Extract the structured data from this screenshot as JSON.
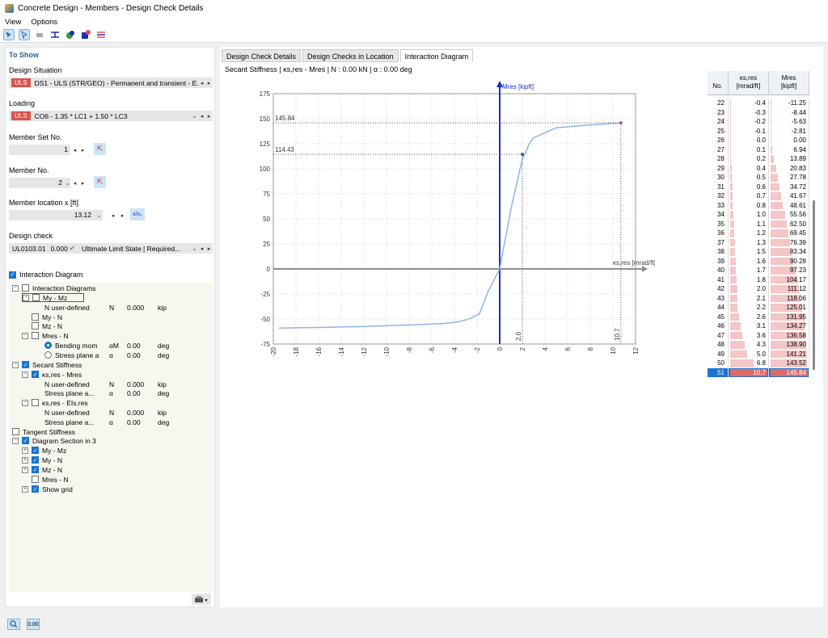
{
  "window": {
    "title": "Concrete Design - Members - Design Check Details"
  },
  "menu": [
    "View",
    "Options"
  ],
  "toolbar": {
    "icons": [
      "select-icon",
      "select-member-icon",
      "eraser-icon",
      "section-icon",
      "result-ok-icon",
      "result-warning-icon",
      "diagram-icon"
    ]
  },
  "left": {
    "to_show": "To Show",
    "design_situation_label": "Design Situation",
    "design_situation_tag": "ULS",
    "design_situation_value": "DS1 - ULS (STR/GEO) - Permanent and transient - E...",
    "loading_label": "Loading",
    "loading_tag": "ULS",
    "loading_value": "CO6 - 1.35 * LC1 + 1.50 * LC3",
    "member_set_label": "Member Set No.",
    "member_set_value": "1",
    "member_no_label": "Member No.",
    "member_no_value": "2",
    "location_label": "Member location x [ft]",
    "location_value": "13.12",
    "location_btn": "x/x₀",
    "check_label": "Design check",
    "check_id": "UL0103.01",
    "check_ratio": "0.000",
    "check_desc": "Ultimate Limit State | Required...",
    "interaction_checkbox": "Interaction Diagram"
  },
  "tree": [
    {
      "id": "t1",
      "x": 12,
      "y": 0,
      "exp": "⊟",
      "cb": false,
      "text": "Interaction Diagrams"
    },
    {
      "id": "t2",
      "x": 24,
      "y": 12,
      "exp": "⊟",
      "cb": false,
      "text": "My - Mz"
    },
    {
      "id": "t3",
      "x": 52,
      "y": 24,
      "text": "N user-defined",
      "sym": "N",
      "val": "0.000",
      "unit": "kip"
    },
    {
      "id": "t4",
      "x": 36,
      "y": 36,
      "cb": false,
      "text": "My - N"
    },
    {
      "id": "t5",
      "x": 36,
      "y": 47,
      "cb": false,
      "text": "Mz - N"
    },
    {
      "id": "t6",
      "x": 24,
      "y": 59,
      "exp": "⊟",
      "cb": false,
      "text": "Mres - N"
    },
    {
      "id": "t7",
      "x": 52,
      "y": 71,
      "radio": true,
      "text": "Bending mom",
      "sym": "αM",
      "val": "0.00",
      "unit": "deg"
    },
    {
      "id": "t8",
      "x": 52,
      "y": 83,
      "radio": false,
      "text": "Stress plane a",
      "sym": "α",
      "val": "0.00",
      "unit": "deg"
    },
    {
      "id": "t9",
      "x": 12,
      "y": 95,
      "exp": "⊟",
      "cb": true,
      "text": "Secant Stiffness"
    },
    {
      "id": "t10",
      "x": 24,
      "y": 107,
      "exp": "⊟",
      "cb": true,
      "text": "κs,res - Mres"
    },
    {
      "id": "t11",
      "x": 52,
      "y": 119,
      "text": "N user-defined",
      "sym": "N",
      "val": "0.000",
      "unit": "kip"
    },
    {
      "id": "t12",
      "x": 52,
      "y": 130,
      "text": "Stress plane a...",
      "sym": "α",
      "val": "0.00",
      "unit": "deg"
    },
    {
      "id": "t13",
      "x": 24,
      "y": 142,
      "exp": "⊟",
      "cb": false,
      "text": "κs,res - EIs,res"
    },
    {
      "id": "t14",
      "x": 52,
      "y": 154,
      "text": "N user-defined",
      "sym": "N",
      "val": "0.000",
      "unit": "kip"
    },
    {
      "id": "t15",
      "x": 52,
      "y": 166,
      "text": "Stress plane a...",
      "sym": "α",
      "val": "0.00",
      "unit": "deg"
    },
    {
      "id": "t16",
      "x": 12,
      "y": 178,
      "cb": false,
      "text": "Tangent Stiffness"
    },
    {
      "id": "t17",
      "x": 12,
      "y": 189,
      "exp": "⊟",
      "cb": true,
      "text": "Diagram Section in 3"
    },
    {
      "id": "t18",
      "x": 24,
      "y": 201,
      "exp": "⊞",
      "cb": true,
      "text": "My - Mz"
    },
    {
      "id": "t19",
      "x": 24,
      "y": 213,
      "exp": "⊞",
      "cb": true,
      "text": "My - N"
    },
    {
      "id": "t20",
      "x": 24,
      "y": 225,
      "exp": "⊞",
      "cb": true,
      "text": "Mz - N"
    },
    {
      "id": "t21",
      "x": 36,
      "y": 237,
      "cb": false,
      "text": "Mres - N"
    },
    {
      "id": "t22",
      "x": 24,
      "y": 249,
      "exp": "⊞",
      "cb": true,
      "text": "Show grid"
    }
  ],
  "tabs": [
    "Design Check Details",
    "Design Checks in Location",
    "Interaction Diagram"
  ],
  "subtitle": "Secant Stiffness | κs,res - Mres | N : 0.00 kN | α : 0.00 deg",
  "chart_data": {
    "type": "line",
    "title": "",
    "xlabel": "κs,res [mrad/ft]",
    "ylabel": "Mres [kipft]",
    "xlim": [
      -20,
      12
    ],
    "ylim": [
      -75,
      175
    ],
    "xticks": [
      -20,
      -18,
      -16,
      -14,
      -12,
      -10,
      -8,
      -6,
      -4,
      -2,
      0,
      2,
      4,
      6,
      8,
      10,
      12
    ],
    "yticks": [
      -75,
      -50,
      -25,
      0,
      25,
      50,
      75,
      100,
      125,
      150,
      175
    ],
    "grid": true,
    "series": [
      {
        "x": [
          -19.5,
          -16,
          -12,
          -8,
          -5,
          -3.8,
          -3,
          -2.5,
          -1.8,
          -1.0,
          0,
          1.0,
          2.0,
          2.3,
          2.6,
          3.0,
          4.0,
          5.0,
          7.0,
          9.0,
          10.7
        ],
        "y": [
          -59,
          -58.5,
          -57.5,
          -56,
          -54.5,
          -53,
          -51,
          -49,
          -45,
          -22,
          0,
          60,
          110,
          116,
          125,
          131,
          136,
          141,
          143,
          144.5,
          145.84
        ],
        "color": "#8db4ea"
      }
    ],
    "annotations": [
      {
        "label": "145.84",
        "x": 10.7,
        "y": 145.84
      },
      {
        "label": "114.43",
        "x": 2.0,
        "y": 114.43
      }
    ],
    "x_markers": [
      {
        "label": "2.0",
        "x": 2.0
      },
      {
        "label": "10.7",
        "x": 10.7
      }
    ]
  },
  "table": {
    "headers": [
      {
        "top": "",
        "bottom": "No."
      },
      {
        "top": "κs,res",
        "bottom": "[mrad/ft]"
      },
      {
        "top": "Mres",
        "bottom": "[kipft]"
      }
    ],
    "rows": [
      [
        "22",
        "-0.4",
        "-11.25"
      ],
      [
        "23",
        "-0.3",
        "-8.44"
      ],
      [
        "24",
        "-0.2",
        "-5.63"
      ],
      [
        "25",
        "-0.1",
        "-2.81"
      ],
      [
        "26",
        "0.0",
        "0.00"
      ],
      [
        "27",
        "0.1",
        "6.94"
      ],
      [
        "28",
        "0.2",
        "13.89"
      ],
      [
        "29",
        "0.4",
        "20.83"
      ],
      [
        "30",
        "0.5",
        "27.78"
      ],
      [
        "31",
        "0.6",
        "34.72"
      ],
      [
        "32",
        "0.7",
        "41.67"
      ],
      [
        "33",
        "0.8",
        "48.61"
      ],
      [
        "34",
        "1.0",
        "55.56"
      ],
      [
        "35",
        "1.1",
        "62.50"
      ],
      [
        "36",
        "1.2",
        "69.45"
      ],
      [
        "37",
        "1.3",
        "76.39"
      ],
      [
        "38",
        "1.5",
        "83.34"
      ],
      [
        "39",
        "1.6",
        "90.28"
      ],
      [
        "40",
        "1.7",
        "97.23"
      ],
      [
        "41",
        "1.8",
        "104.17"
      ],
      [
        "42",
        "2.0",
        "111.12"
      ],
      [
        "43",
        "2.1",
        "118.06"
      ],
      [
        "44",
        "2.2",
        "125.01"
      ],
      [
        "45",
        "2.6",
        "131.95"
      ],
      [
        "46",
        "3.1",
        "134.27"
      ],
      [
        "47",
        "3.6",
        "136.58"
      ],
      [
        "48",
        "4.3",
        "138.90"
      ],
      [
        "49",
        "5.0",
        "141.21"
      ],
      [
        "50",
        "6.8",
        "143.52"
      ],
      [
        "51",
        "10.7",
        "145.84"
      ]
    ],
    "selected": "51"
  },
  "status": {
    "icons": [
      "view-icon",
      "decimal-icon"
    ],
    "decimal_label": "0.00"
  },
  "colors": {
    "accent": "#1a73d2",
    "uls": "#d9534f",
    "axis": "#1f2fb5",
    "curve": "#8db4ea"
  }
}
